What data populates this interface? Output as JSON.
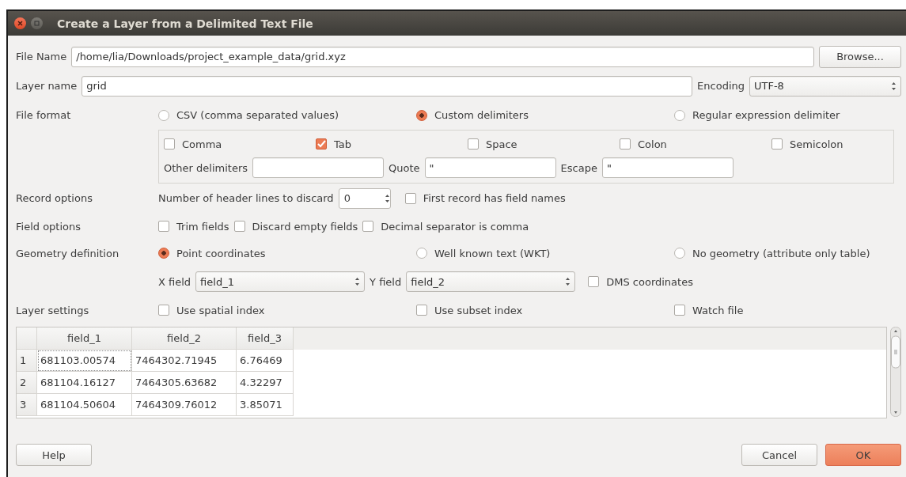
{
  "window": {
    "title": "Create a Layer from a Delimited Text File"
  },
  "file_name": {
    "label": "File Name",
    "value": "/home/lia/Downloads/project_example_data/grid.xyz",
    "button": "Browse..."
  },
  "layer_name": {
    "label": "Layer name",
    "value": "grid"
  },
  "encoding": {
    "label": "Encoding",
    "value": "UTF-8"
  },
  "file_format": {
    "label": "File format",
    "options": [
      {
        "label": "CSV (comma separated values)",
        "selected": false
      },
      {
        "label": "Custom delimiters",
        "selected": true
      },
      {
        "label": "Regular expression delimiter",
        "selected": false
      }
    ],
    "delimiters": [
      {
        "label": "Comma",
        "checked": false
      },
      {
        "label": "Tab",
        "checked": true
      },
      {
        "label": "Space",
        "checked": false
      },
      {
        "label": "Colon",
        "checked": false
      },
      {
        "label": "Semicolon",
        "checked": false
      }
    ],
    "other_delimiters": {
      "label": "Other delimiters"
    },
    "quote": {
      "label": "Quote",
      "value": "\""
    },
    "escape": {
      "label": "Escape",
      "value": "\""
    }
  },
  "record_options": {
    "label": "Record options",
    "header_lines": {
      "label": "Number of header lines to discard",
      "value": "0"
    },
    "first_record": {
      "label": "First record has field names",
      "checked": false
    }
  },
  "field_options": {
    "label": "Field options",
    "checkboxes": [
      {
        "label": "Trim fields",
        "checked": false
      },
      {
        "label": "Discard empty fields",
        "checked": false
      },
      {
        "label": "Decimal separator is comma",
        "checked": false
      }
    ]
  },
  "geometry": {
    "label": "Geometry definition",
    "options": [
      {
        "label": "Point coordinates",
        "selected": true
      },
      {
        "label": "Well known text (WKT)",
        "selected": false
      },
      {
        "label": "No geometry (attribute only table)",
        "selected": false
      }
    ],
    "x_field": {
      "label": "X field",
      "value": "field_1"
    },
    "y_field": {
      "label": "Y field",
      "value": "field_2"
    },
    "dms": {
      "label": "DMS coordinates",
      "checked": false
    }
  },
  "layer_settings": {
    "label": "Layer settings",
    "checkboxes": [
      {
        "label": "Use spatial index",
        "checked": false
      },
      {
        "label": "Use subset index",
        "checked": false
      },
      {
        "label": "Watch file",
        "checked": false
      }
    ]
  },
  "table": {
    "columns": [
      "field_1",
      "field_2",
      "field_3"
    ],
    "rows": [
      {
        "number": "1",
        "cells": [
          "681103.00574",
          "7464302.71945",
          "6.76469"
        ]
      },
      {
        "number": "2",
        "cells": [
          "681104.16127",
          "7464305.63682",
          "4.32297"
        ]
      },
      {
        "number": "3",
        "cells": [
          "681104.50604",
          "7464309.76012",
          "3.85071"
        ]
      }
    ]
  },
  "help_button": {
    "label": "Help"
  },
  "buttons": [
    {
      "label": "Cancel",
      "primary": false
    },
    {
      "label": "OK",
      "primary": true
    }
  ]
}
